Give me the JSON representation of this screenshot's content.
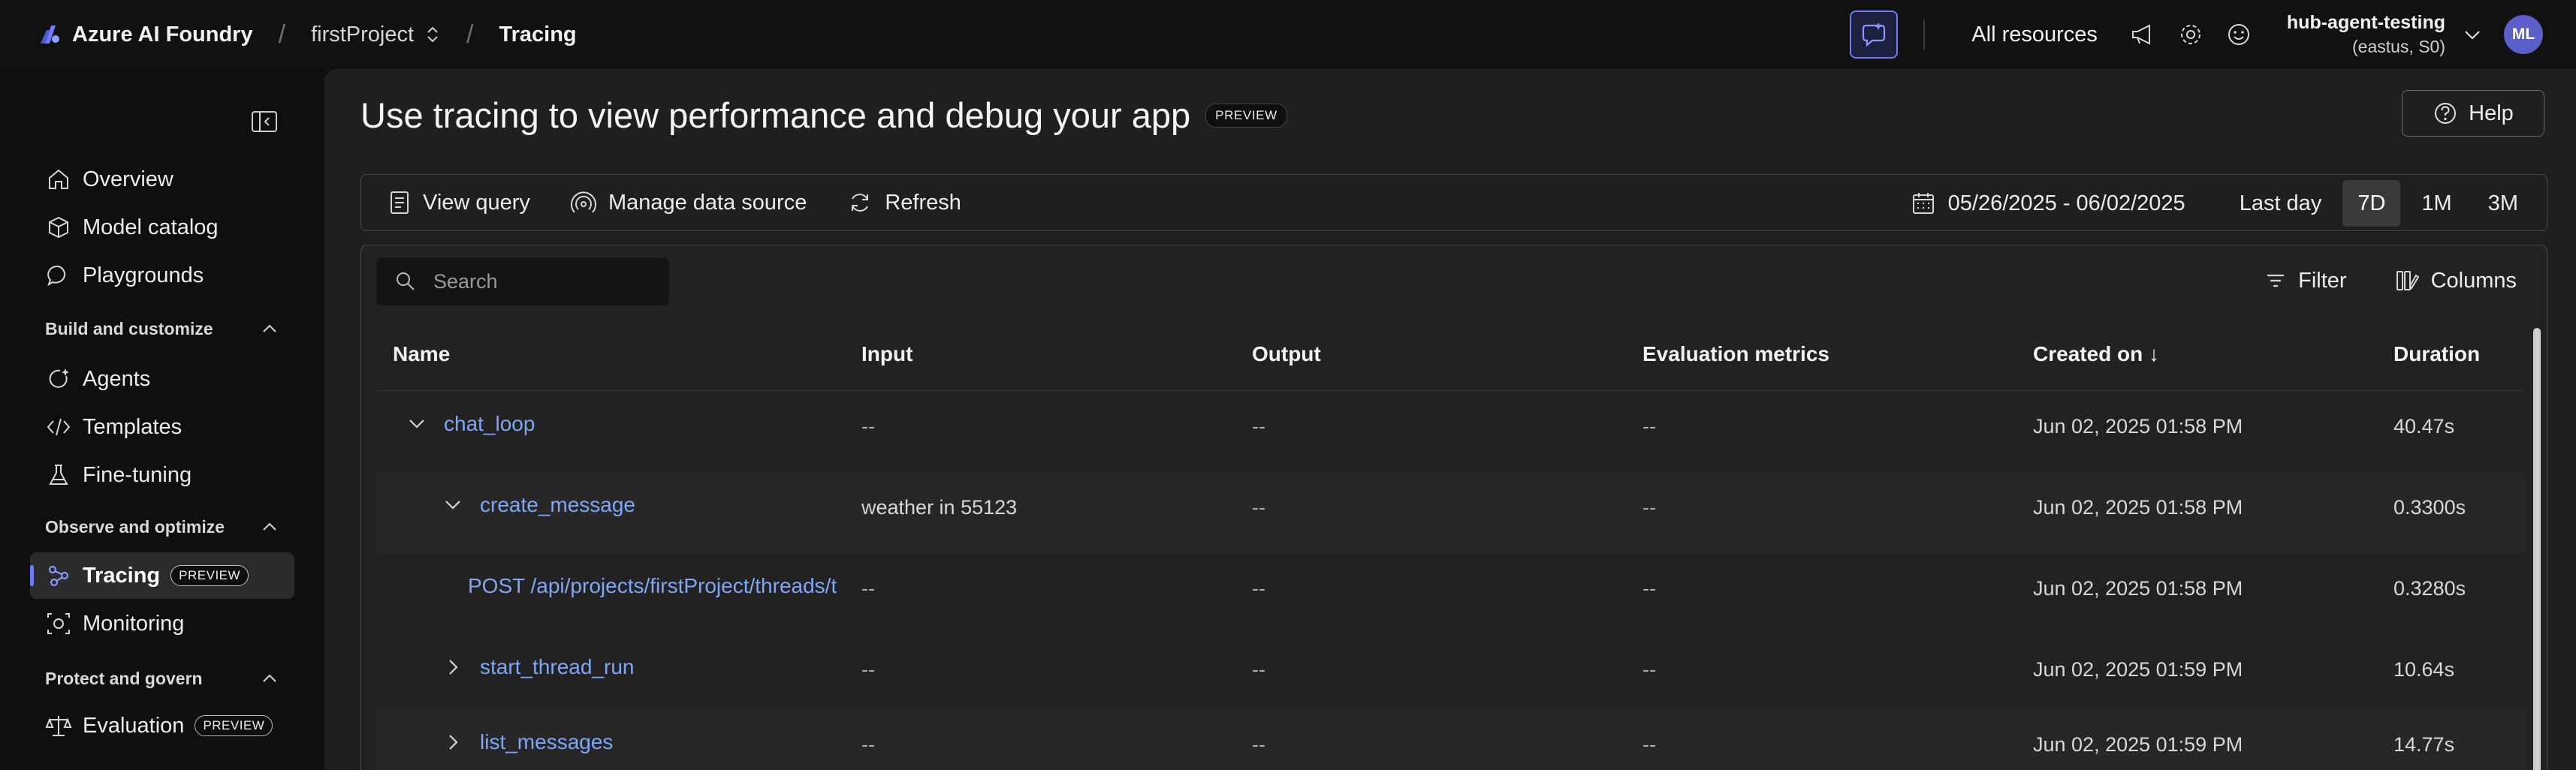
{
  "topbar": {
    "brand": "Azure AI Foundry",
    "breadcrumb": [
      "firstProject",
      "Tracing"
    ],
    "all_resources": "All resources",
    "hub_name": "hub-agent-testing",
    "hub_region": "(eastus, S0)",
    "avatar_initials": "ML"
  },
  "sidebar": {
    "items_top": [
      {
        "label": "Overview",
        "icon": "home-icon"
      },
      {
        "label": "Model catalog",
        "icon": "cube-icon"
      },
      {
        "label": "Playgrounds",
        "icon": "chat-icon"
      }
    ],
    "sections": [
      {
        "label": "Build and customize",
        "items": [
          {
            "label": "Agents",
            "icon": "agent-icon"
          },
          {
            "label": "Templates",
            "icon": "code-icon"
          },
          {
            "label": "Fine-tuning",
            "icon": "flask-icon"
          }
        ]
      },
      {
        "label": "Observe and optimize",
        "items": [
          {
            "label": "Tracing",
            "icon": "tracing-icon",
            "badge": "PREVIEW",
            "selected": true
          },
          {
            "label": "Monitoring",
            "icon": "monitor-icon"
          }
        ]
      },
      {
        "label": "Protect and govern",
        "items": [
          {
            "label": "Evaluation",
            "icon": "scale-icon",
            "badge": "PREVIEW"
          }
        ]
      }
    ]
  },
  "main": {
    "title": "Use tracing to view performance and debug your app",
    "title_badge": "PREVIEW",
    "help": "Help",
    "toolbar": {
      "view_query": "View query",
      "manage_data_source": "Manage data source",
      "refresh": "Refresh",
      "date_range": "05/26/2025 - 06/02/2025",
      "ranges": [
        "Last day",
        "7D",
        "1M",
        "3M"
      ],
      "active_range": "7D"
    },
    "search_placeholder": "Search",
    "filter": "Filter",
    "columns": "Columns",
    "table": {
      "headers": [
        "Name",
        "Input",
        "Output",
        "Evaluation metrics",
        "Created on ↓",
        "Duration"
      ],
      "rows": [
        {
          "name": "chat_loop",
          "chevron": "down",
          "indent": 0,
          "input": "--",
          "output": "--",
          "eval": "--",
          "created": "Jun 02, 2025 01:58 PM",
          "duration": "40.47s"
        },
        {
          "name": "create_message",
          "chevron": "down",
          "indent": 1,
          "input": "weather in 55123",
          "output": "--",
          "eval": "--",
          "created": "Jun 02, 2025 01:58 PM",
          "duration": "0.3300s"
        },
        {
          "name": "POST /api/projects/firstProject/threads/t",
          "chevron": "none",
          "indent": 2,
          "input": "--",
          "output": "--",
          "eval": "--",
          "created": "Jun 02, 2025 01:58 PM",
          "duration": "0.3280s"
        },
        {
          "name": "start_thread_run",
          "chevron": "right",
          "indent": 1,
          "input": "--",
          "output": "--",
          "eval": "--",
          "created": "Jun 02, 2025 01:59 PM",
          "duration": "10.64s"
        },
        {
          "name": "list_messages",
          "chevron": "right",
          "indent": 1,
          "input": "--",
          "output": "--",
          "eval": "--",
          "created": "Jun 02, 2025 01:59 PM",
          "duration": "14.77s"
        }
      ]
    }
  },
  "colors": {
    "accent": "#6f7bf7",
    "link": "#7fa7f5",
    "avatar": "#5b5fc7"
  }
}
